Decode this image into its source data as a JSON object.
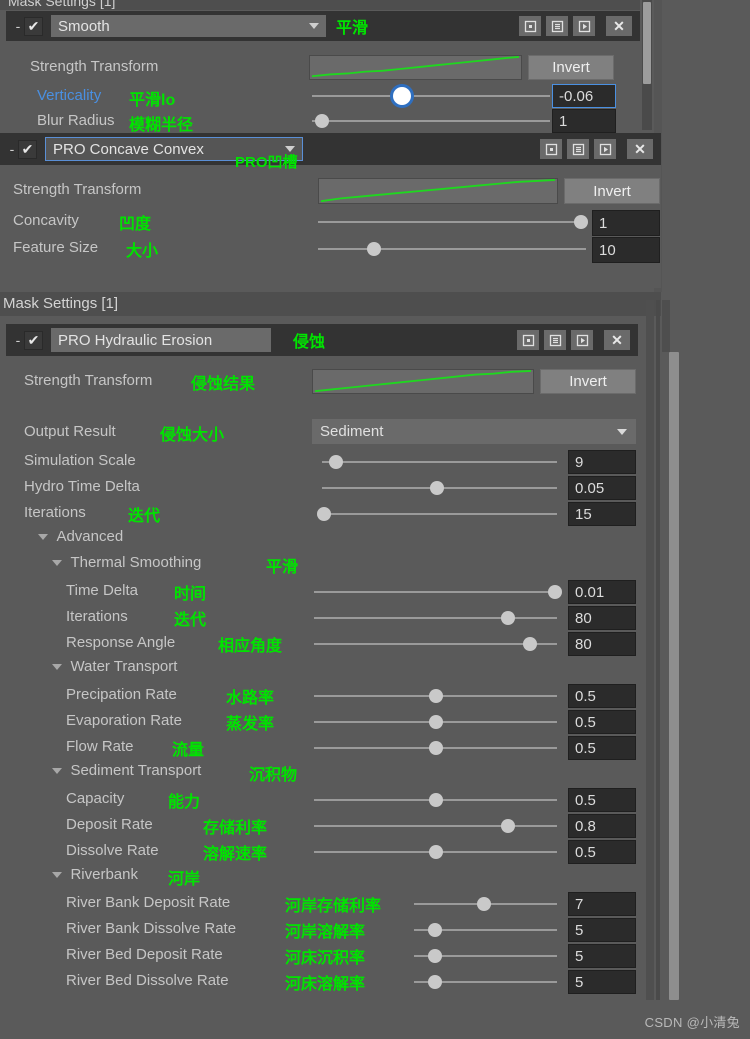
{
  "app": {
    "background": "#5a5a5a",
    "accent_green": "#00e400",
    "accent_blue": "#4a90e2",
    "watermark": "CSDN @小清兔"
  },
  "top_clipped_title": "Mask Settings [1]",
  "panels": [
    {
      "id": "smooth",
      "header": {
        "collapse": "-",
        "check": "✔",
        "name": "Smooth",
        "cn": "平滑",
        "buttons": [
          "preset-icon",
          "list-icon",
          "play-icon"
        ],
        "close": "✕"
      },
      "rows": [
        {
          "label": "Strength Transform",
          "cn": "",
          "type": "curve",
          "invert": "Invert"
        },
        {
          "label": "Verticality",
          "label_color": "blue",
          "cn": "平滑lo",
          "type": "slider",
          "value": "-0.06",
          "pos": 38,
          "focus": true
        },
        {
          "label": "Blur Radius",
          "cn": "模糊半径",
          "type": "slider",
          "value": "1",
          "pos": 4,
          "focus": false
        }
      ]
    },
    {
      "id": "concave-convex",
      "header": {
        "collapse": "-",
        "check": "✔",
        "name": "PRO Concave Convex",
        "cn": "PRO凹槽",
        "buttons": [
          "preset-icon",
          "list-icon",
          "play-icon"
        ],
        "close": "✕"
      },
      "rows": [
        {
          "label": "Strength Transform",
          "cn": "",
          "type": "curve",
          "invert": "Invert"
        },
        {
          "label": "Concavity",
          "cn": "凹度",
          "type": "slider",
          "value": "1",
          "pos": 98,
          "focus": false
        },
        {
          "label": "Feature Size",
          "cn": "大小",
          "type": "slider",
          "value": "10",
          "pos": 21,
          "focus": false
        }
      ]
    }
  ],
  "mask_settings": {
    "title": "Mask Settings [1]",
    "header": {
      "collapse": "-",
      "check": "✔",
      "name": "PRO Hydraulic Erosion",
      "cn": "侵蚀",
      "buttons": [
        "preset-icon",
        "list-icon",
        "play-icon"
      ],
      "close": "✕"
    },
    "strength_transform": {
      "label": "Strength Transform",
      "cn": "侵蚀结果",
      "invert": "Invert"
    },
    "output_result": {
      "label": "Output Result",
      "cn": "侵蚀大小",
      "value": "Sediment"
    },
    "sliders": [
      {
        "label": "Simulation Scale",
        "cn": "",
        "value": "9",
        "pos": 6,
        "indent": 0
      },
      {
        "label": "Hydro Time Delta",
        "cn": "",
        "value": "0.05",
        "pos": 49,
        "indent": 0
      },
      {
        "label": "Iterations",
        "cn": "迭代",
        "value": "15",
        "pos": 0,
        "indent": 0
      }
    ],
    "groups": [
      {
        "caret": "▼",
        "label": "Advanced",
        "cn": "",
        "indent": 1
      },
      {
        "caret": "▼",
        "label": "Thermal Smoothing",
        "cn": "平滑",
        "indent": 2
      }
    ],
    "thermal": [
      {
        "label": "Time Delta",
        "cn": "时间",
        "value": "0.01",
        "pos": 99
      },
      {
        "label": "Iterations",
        "cn": "迭代",
        "value": "80",
        "pos": 80
      },
      {
        "label": "Response Angle",
        "cn": "相应角度",
        "value": "80",
        "pos": 89
      }
    ],
    "water_group": {
      "caret": "▼",
      "label": "Water Transport",
      "cn": ""
    },
    "water": [
      {
        "label": "Precipation Rate",
        "cn": "水路率",
        "value": "0.5",
        "pos": 50
      },
      {
        "label": "Evaporation Rate",
        "cn": "蒸发率",
        "value": "0.5",
        "pos": 50
      },
      {
        "label": "Flow Rate",
        "cn": "流量",
        "value": "0.5",
        "pos": 50
      }
    ],
    "sediment_group": {
      "caret": "▼",
      "label": "Sediment Transport",
      "cn": "沉积物"
    },
    "sediment": [
      {
        "label": "Capacity",
        "cn": "能力",
        "value": "0.5",
        "pos": 50
      },
      {
        "label": "Deposit Rate",
        "cn": "存储利率",
        "value": "0.8",
        "pos": 80
      },
      {
        "label": "Dissolve Rate",
        "cn": "溶解速率",
        "value": "0.5",
        "pos": 50
      }
    ],
    "riverbank_group": {
      "caret": "▼",
      "label": "Riverbank",
      "cn": "河岸"
    },
    "riverbank": [
      {
        "label": "River Bank Deposit Rate",
        "cn": "河岸存储利率",
        "value": "7",
        "pos": 66
      },
      {
        "label": "River Bank Dissolve Rate",
        "cn": "河岸溶解率",
        "value": "5",
        "pos": 47
      },
      {
        "label": "River Bed Deposit Rate",
        "cn": "河床沉积率",
        "value": "5",
        "pos": 47
      },
      {
        "label": "River Bed Dissolve Rate",
        "cn": "河床溶解率",
        "value": "5",
        "pos": 47
      }
    ]
  }
}
